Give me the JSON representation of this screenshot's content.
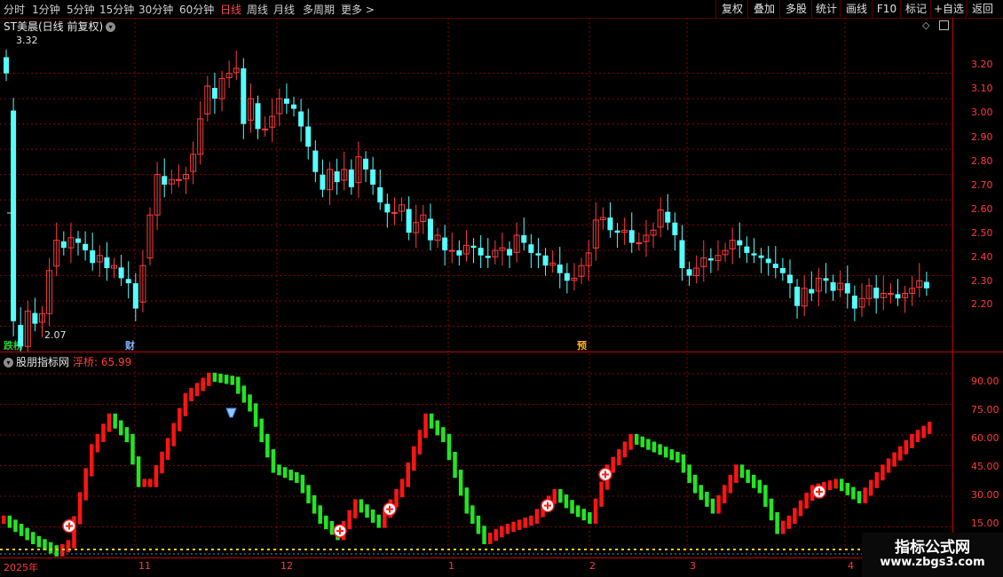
{
  "toolbar": {
    "periods": [
      "分时",
      "1分钟",
      "5分钟",
      "15分钟",
      "30分钟",
      "60分钟",
      "日线",
      "周线",
      "月线",
      "多周期",
      "更多"
    ],
    "active_period": "日线",
    "more_arrow": ">",
    "tools": [
      "复权",
      "叠加",
      "多股",
      "统计",
      "画线",
      "F10",
      "标记",
      "+自选",
      "返回"
    ]
  },
  "stock": {
    "name": "ST美晨",
    "mode": "(日线 前复权)",
    "high_label": "3.32",
    "low_label": "2.07",
    "toggle_icon": "chevron-down-icon"
  },
  "indicator": {
    "source": "股朋指标网",
    "name": "浮桥:",
    "value": "65.99"
  },
  "price_axis": [
    "3.20",
    "3.10",
    "3.00",
    "2.90",
    "2.80",
    "2.70",
    "2.60",
    "2.50",
    "2.40",
    "2.30",
    "2.20"
  ],
  "ind_axis": [
    "90.00",
    "75.00",
    "60.00",
    "45.00",
    "30.00",
    "15.00"
  ],
  "dates": [
    "2025年",
    "11",
    "12",
    "1",
    "2",
    "3",
    "4"
  ],
  "markers": {
    "m1": "跌榜",
    "m2": "财",
    "m3": "预"
  },
  "watermark": {
    "title": "指标公式网",
    "url": "www.zbgs3.com"
  },
  "colors": {
    "up": "#ff3b3b",
    "down": "#54ffff",
    "bg": "#000000",
    "grid": "#8a0000",
    "signal_up": "#ff1414",
    "signal_down": "#22e622"
  },
  "chart_data": [
    {
      "type": "candlestick",
      "ylim": [
        2.1,
        3.42
      ],
      "ticks": [
        3.2,
        3.1,
        3.0,
        2.9,
        2.8,
        2.7,
        2.6,
        2.5,
        2.4,
        2.3,
        2.2
      ],
      "annotations": {
        "high": 3.32,
        "low": 2.07
      },
      "closes": [
        3.2,
        2.22,
        2.12,
        2.26,
        2.21,
        2.25,
        2.42,
        2.54,
        2.51,
        2.55,
        2.53,
        2.5,
        2.45,
        2.48,
        2.43,
        2.44,
        2.39,
        2.37,
        2.27,
        2.44,
        2.64,
        2.8,
        2.76,
        2.78,
        2.78,
        2.8,
        2.88,
        3.02,
        3.15,
        3.1,
        3.18,
        3.2,
        3.22,
        3.0,
        3.1,
        2.98,
        2.98,
        3.03,
        3.1,
        3.08,
        3.06,
        2.99,
        2.91,
        2.81,
        2.74,
        2.82,
        2.77,
        2.82,
        2.75,
        2.87,
        2.82,
        2.76,
        2.69,
        2.65,
        2.65,
        2.68,
        2.57,
        2.61,
        2.64,
        2.54,
        2.56,
        2.5,
        2.5,
        2.48,
        2.52,
        2.51,
        2.48,
        2.47,
        2.5,
        2.51,
        2.48,
        2.56,
        2.53,
        2.49,
        2.48,
        2.44,
        2.45,
        2.41,
        2.38,
        2.39,
        2.44,
        2.49,
        2.62,
        2.63,
        2.58,
        2.57,
        2.58,
        2.53,
        2.53,
        2.56,
        2.58,
        2.66,
        2.61,
        2.56,
        2.43,
        2.4,
        2.43,
        2.47,
        2.46,
        2.48,
        2.5,
        2.54,
        2.52,
        2.49,
        2.48,
        2.47,
        2.45,
        2.43,
        2.41,
        2.37,
        2.28,
        2.35,
        2.33,
        2.39,
        2.38,
        2.34,
        2.37,
        2.33,
        2.27,
        2.31,
        2.36,
        2.31,
        2.33,
        2.33,
        2.31,
        2.33,
        2.35,
        2.38,
        2.35
      ],
      "dividers": {
        "11": 152,
        "12": 312,
        "1": 505,
        "2": 664,
        "3": 774,
        "4": 952
      }
    },
    {
      "type": "bar",
      "name": "浮桥",
      "ylim": [
        0,
        100
      ],
      "ticks": [
        90,
        75,
        60,
        45,
        30,
        15
      ],
      "current": 65.99,
      "buy_markers": [
        11,
        53,
        60,
        88,
        92,
        112,
        116,
        125
      ]
    }
  ]
}
